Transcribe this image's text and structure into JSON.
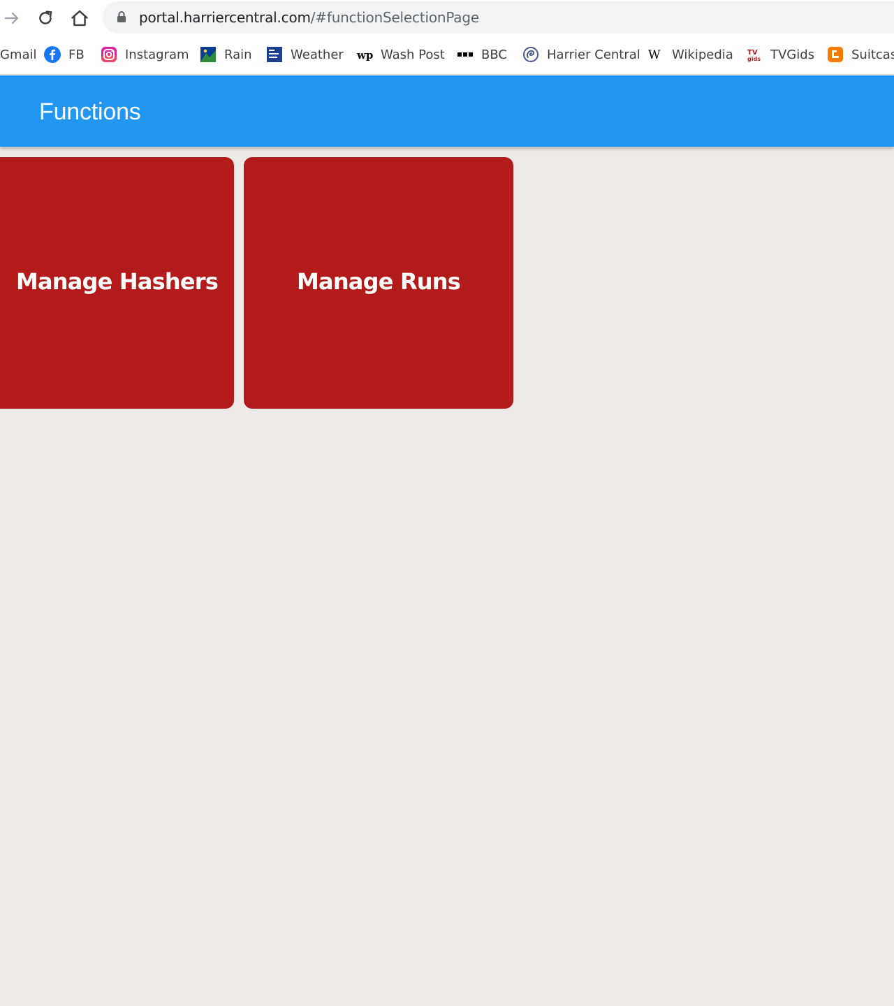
{
  "browser": {
    "url_host": "portal.harriercentral.com",
    "url_path": "/#functionSelectionPage",
    "nav": {
      "forward_icon": "arrow-right-icon",
      "reload_icon": "reload-icon",
      "home_icon": "home-icon",
      "lock_icon": "lock-icon"
    },
    "bookmarks": [
      {
        "label": "Gmail",
        "icon": "gmail-icon"
      },
      {
        "label": "FB",
        "icon": "facebook-icon"
      },
      {
        "label": "Instagram",
        "icon": "instagram-icon"
      },
      {
        "label": "Rain",
        "icon": "rain-icon"
      },
      {
        "label": "Weather",
        "icon": "weather-channel-icon"
      },
      {
        "label": "Wash Post",
        "icon": "washington-post-icon"
      },
      {
        "label": "BBC",
        "icon": "bbc-icon"
      },
      {
        "label": "Harrier Central",
        "icon": "harrier-central-icon"
      },
      {
        "label": "Wikipedia",
        "icon": "wikipedia-icon"
      },
      {
        "label": "TVGids",
        "icon": "tvgids-icon"
      },
      {
        "label": "Suitcase",
        "icon": "blogger-icon"
      }
    ]
  },
  "app": {
    "title": "Functions",
    "colors": {
      "appbar": "#2196f3",
      "tile": "#b31a1a",
      "background": "#eeeae7"
    },
    "tiles": [
      {
        "label": "Manage Hashers"
      },
      {
        "label": "Manage Runs"
      }
    ]
  }
}
